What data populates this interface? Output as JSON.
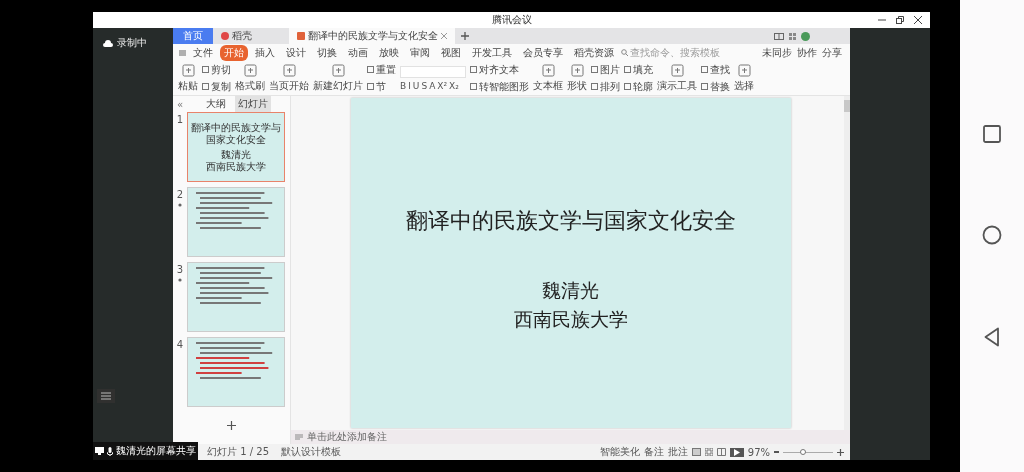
{
  "meeting": {
    "title": "腾讯会议",
    "recording": "录制中",
    "share_label": "魏清光的屏幕共享"
  },
  "wps": {
    "tabs": [
      {
        "label": "首页",
        "kind": "home",
        "selected": false
      },
      {
        "label": "稻壳",
        "kind": "docer",
        "selected": false
      },
      {
        "label": "翻译中的民族文学与文化安全",
        "kind": "doc",
        "selected": true
      }
    ],
    "menu": [
      {
        "label": "文件",
        "selected": false
      },
      {
        "label": "开始",
        "selected": true
      },
      {
        "label": "插入",
        "selected": false
      },
      {
        "label": "设计",
        "selected": false
      },
      {
        "label": "切换",
        "selected": false
      },
      {
        "label": "动画",
        "selected": false
      },
      {
        "label": "放映",
        "selected": false
      },
      {
        "label": "审阅",
        "selected": false
      },
      {
        "label": "视图",
        "selected": false
      },
      {
        "label": "开发工具",
        "selected": false
      },
      {
        "label": "会员专享",
        "selected": false
      },
      {
        "label": "稻壳资源",
        "selected": false
      }
    ],
    "search": {
      "placeholder": "查找命令、搜索模板"
    },
    "actions": [
      "未同步",
      "协作",
      "分享"
    ],
    "ribbon": [
      {
        "kind": "big",
        "label": "粘贴"
      },
      {
        "kind": "pair",
        "items": [
          "剪切",
          "复制"
        ]
      },
      {
        "kind": "big",
        "label": "格式刷"
      },
      {
        "kind": "big",
        "label": "当页开始"
      },
      {
        "kind": "big",
        "label": "新建幻灯片"
      },
      {
        "kind": "pair",
        "items": [
          "重置",
          "节"
        ]
      },
      {
        "kind": "font",
        "items": [
          "B",
          "I",
          "U",
          "S",
          "A",
          "X²",
          "X₂"
        ]
      },
      {
        "kind": "pair",
        "items": [
          "对齐文本",
          "转智能图形"
        ]
      },
      {
        "kind": "big",
        "label": "文本框"
      },
      {
        "kind": "big",
        "label": "形状"
      },
      {
        "kind": "pair",
        "items": [
          "图片",
          "排列"
        ]
      },
      {
        "kind": "pair",
        "items": [
          "填充",
          "轮廓"
        ]
      },
      {
        "kind": "big",
        "label": "演示工具"
      },
      {
        "kind": "pair",
        "items": [
          "查找",
          "替换"
        ]
      },
      {
        "kind": "big",
        "label": "选择"
      }
    ],
    "collapse": "«",
    "panel_tabs": [
      {
        "label": "大纲",
        "selected": false
      },
      {
        "label": "幻灯片",
        "selected": true
      }
    ],
    "slides": [
      {
        "number": "1",
        "kind": "title",
        "selected": true,
        "animated": false,
        "lines": [
          "翻译中的民族文学与国家文化安全",
          "魏清光",
          "西南民族大学"
        ]
      },
      {
        "number": "2",
        "kind": "bullets",
        "selected": false,
        "animated": true,
        "highlighted": false
      },
      {
        "number": "3",
        "kind": "bullets",
        "selected": false,
        "animated": true,
        "highlighted": false
      },
      {
        "number": "4",
        "kind": "bullets",
        "selected": false,
        "animated": false,
        "highlighted": true
      }
    ],
    "current_slide": {
      "title": "翻译中的民族文学与国家文化安全",
      "author": "魏清光",
      "affiliation": "西南民族大学"
    },
    "notes": {
      "placeholder": "单击此处添加备注"
    },
    "status_bar": {
      "slide_count": "幻灯片 1 / 25",
      "template": "默认设计模板",
      "beautify": "智能美化",
      "notes": "备注",
      "comments": "批注",
      "zoom": "97%",
      "zoom_level": {
        "level": 0.4
      }
    }
  }
}
